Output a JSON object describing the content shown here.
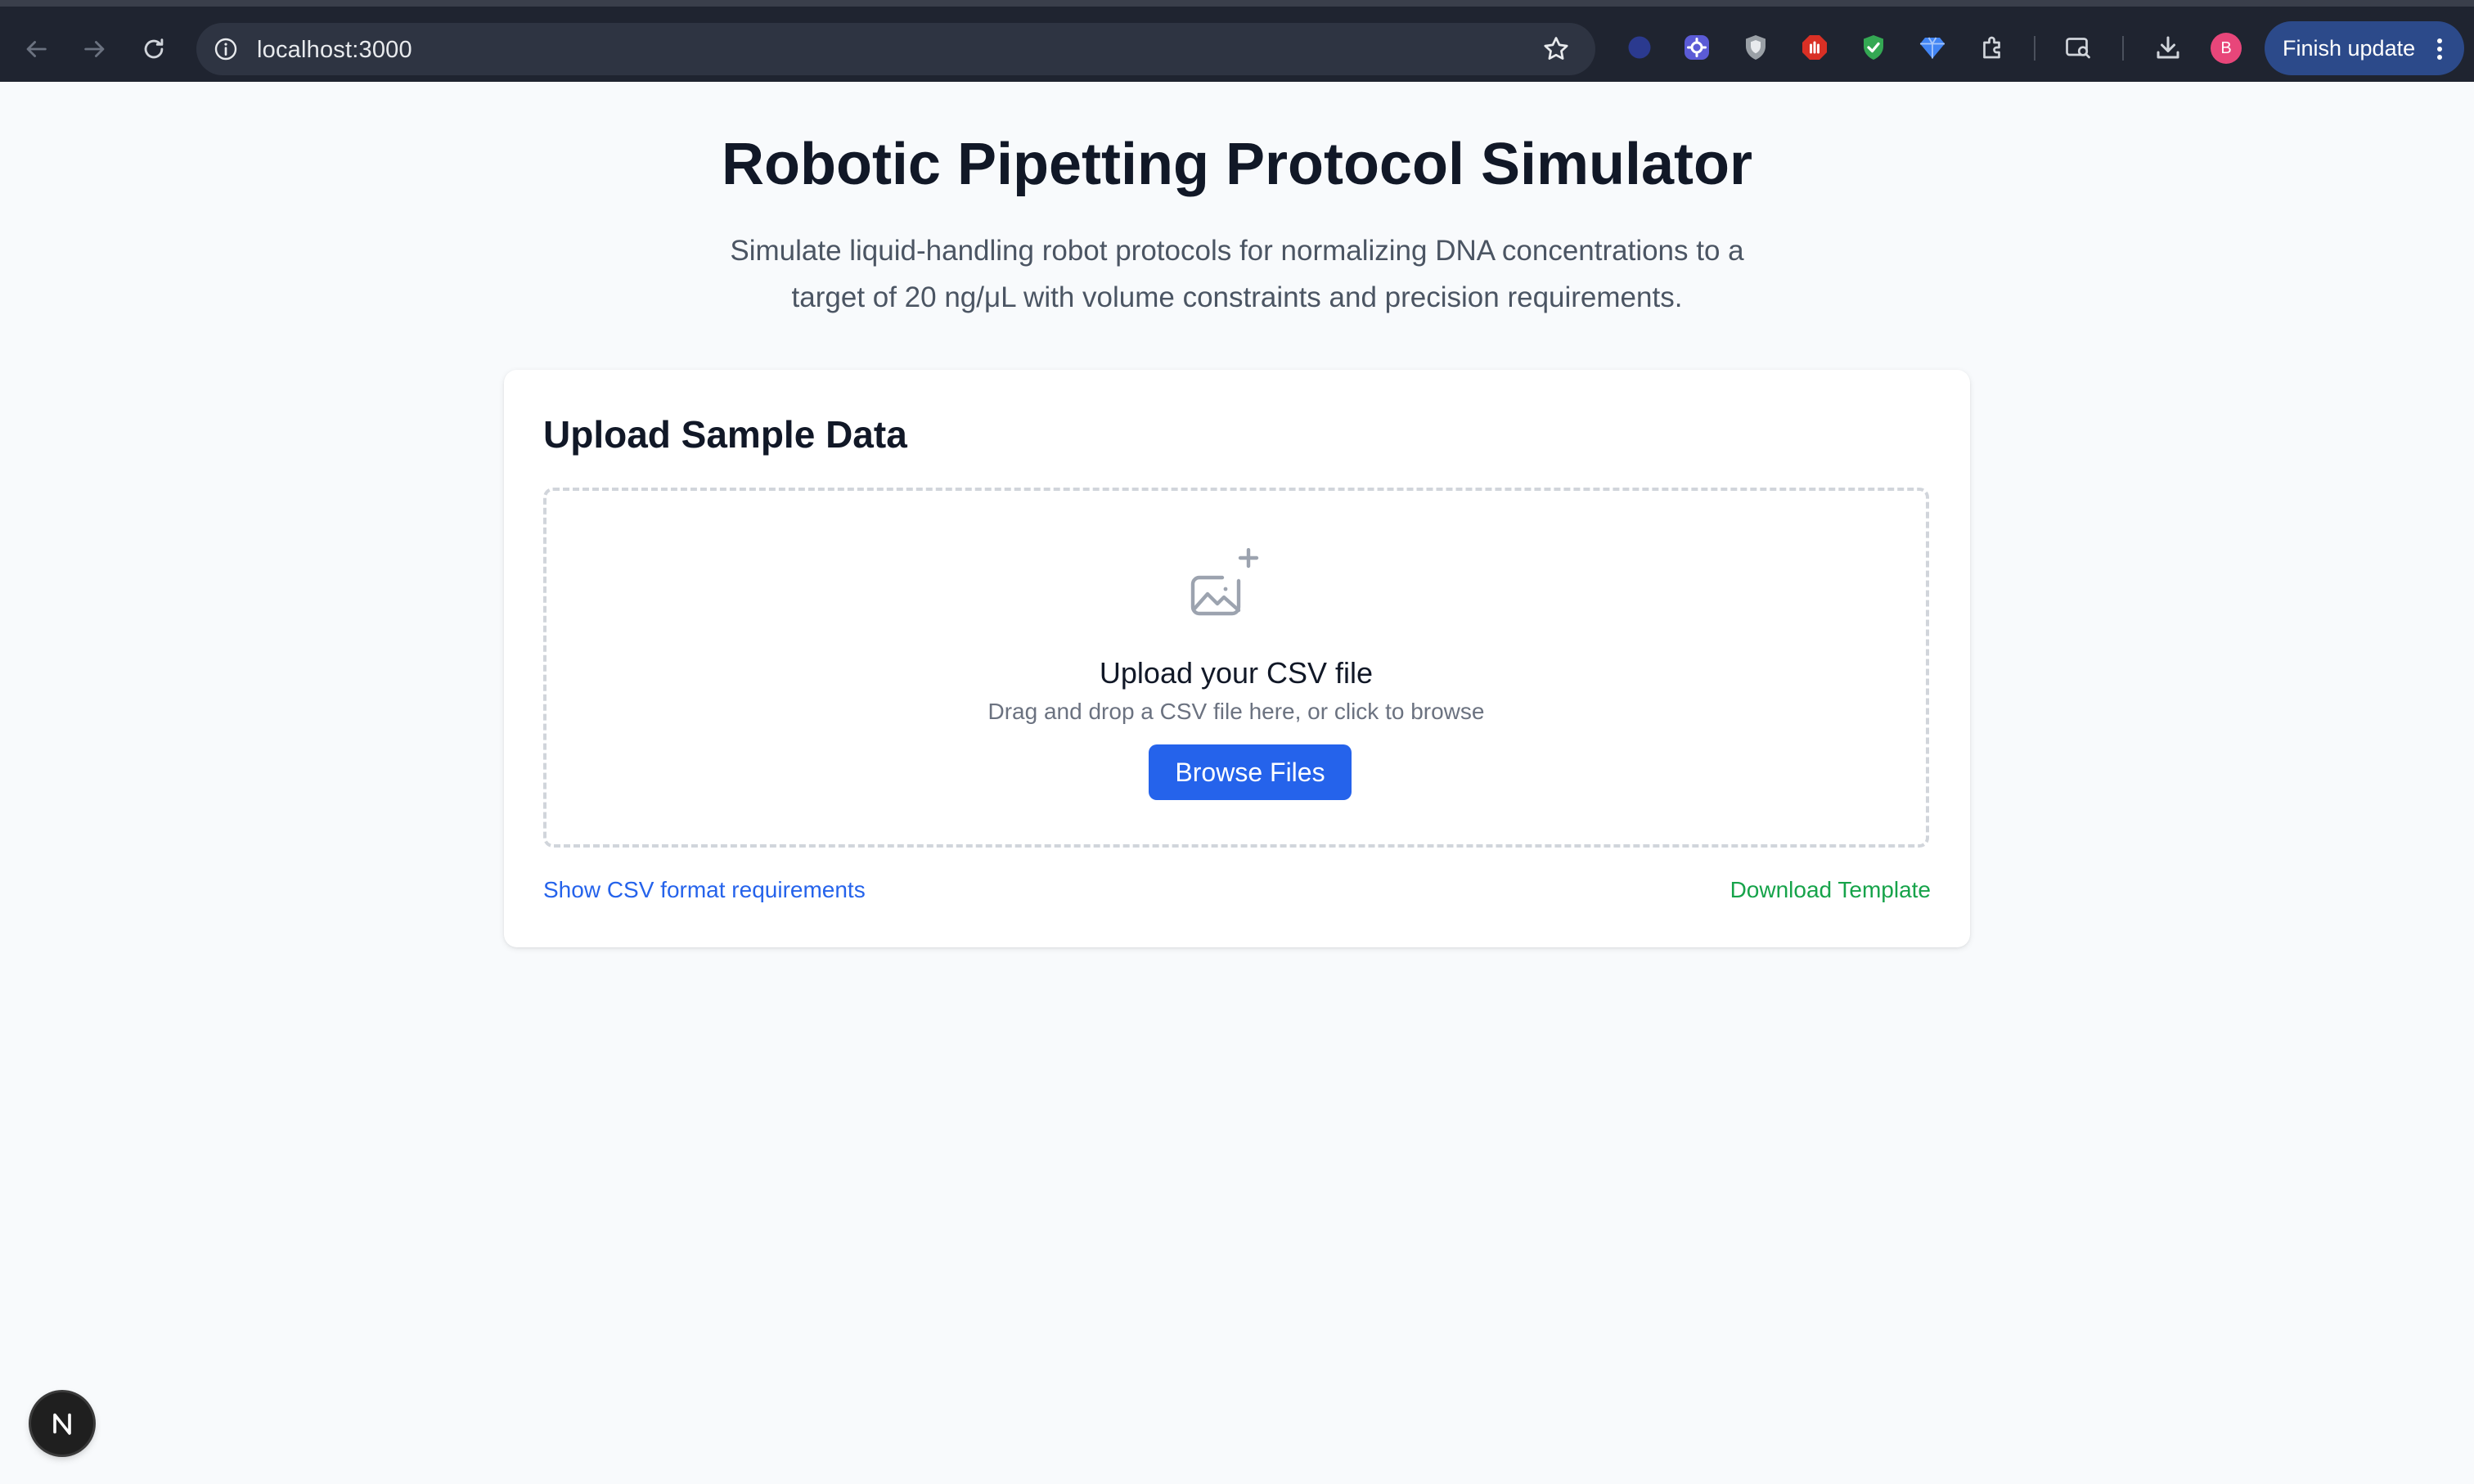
{
  "browser": {
    "url": "localhost:3000",
    "profile_initial": "B",
    "finish_update_label": "Finish update",
    "icons": [
      "back-icon",
      "forward-icon",
      "reload-icon",
      "info-icon",
      "star-icon",
      "extension-icon",
      "tab-search-icon",
      "download-icon",
      "more-icon"
    ]
  },
  "page": {
    "title": "Robotic Pipetting Protocol Simulator",
    "subtitle": "Simulate liquid-handling robot protocols for normalizing DNA concentrations to a target of 20 ng/μL with volume constraints and precision requirements."
  },
  "upload_card": {
    "title": "Upload Sample Data",
    "dropzone_title": "Upload your CSV file",
    "dropzone_hint": "Drag and drop a CSV file here, or click to browse",
    "browse_label": "Browse Files",
    "requirements_link": "Show CSV format requirements",
    "template_link": "Download Template"
  },
  "dev_badge": {
    "letter": "N"
  },
  "colors": {
    "primary": "#2563eb",
    "success": "#16a34a",
    "background": "#f8fafc",
    "chrome": "#1f2430"
  }
}
